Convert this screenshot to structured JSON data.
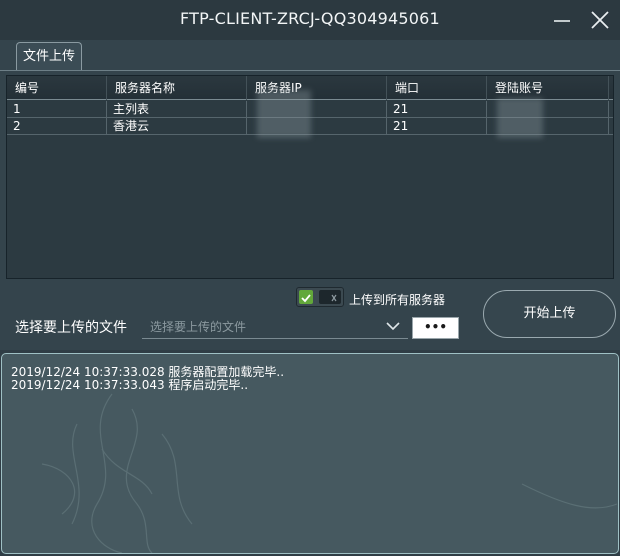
{
  "window": {
    "title": "FTP-CLIENT-ZRCJ-QQ304945061",
    "icons": [
      "minimize-icon",
      "close-icon"
    ]
  },
  "tabs": [
    {
      "label": "文件上传",
      "active": true
    }
  ],
  "table": {
    "columns": [
      "编号",
      "服务器名称",
      "服务器IP",
      "端口",
      "登陆账号"
    ],
    "rows": [
      {
        "id": "1",
        "name": "主列表",
        "ip": "",
        "port": "21",
        "account": ""
      },
      {
        "id": "2",
        "name": "香港云",
        "ip": "",
        "port": "21",
        "account": ""
      }
    ]
  },
  "upload": {
    "toggle_label": "上传到所有服务器",
    "toggle_on": true,
    "file_label": "选择要上传的文件",
    "file_placeholder": "选择要上传的文件",
    "browse_label": "•••",
    "start_label": "开始上传"
  },
  "log": {
    "lines": [
      "2019/12/24 10:37:33.028 服务器配置加载完毕..",
      "2019/12/24 10:37:33.043 程序启动完毕.."
    ]
  },
  "colors": {
    "background": "#2f3d45",
    "toggle_on": "#62a83a",
    "log_background": "#465960"
  }
}
